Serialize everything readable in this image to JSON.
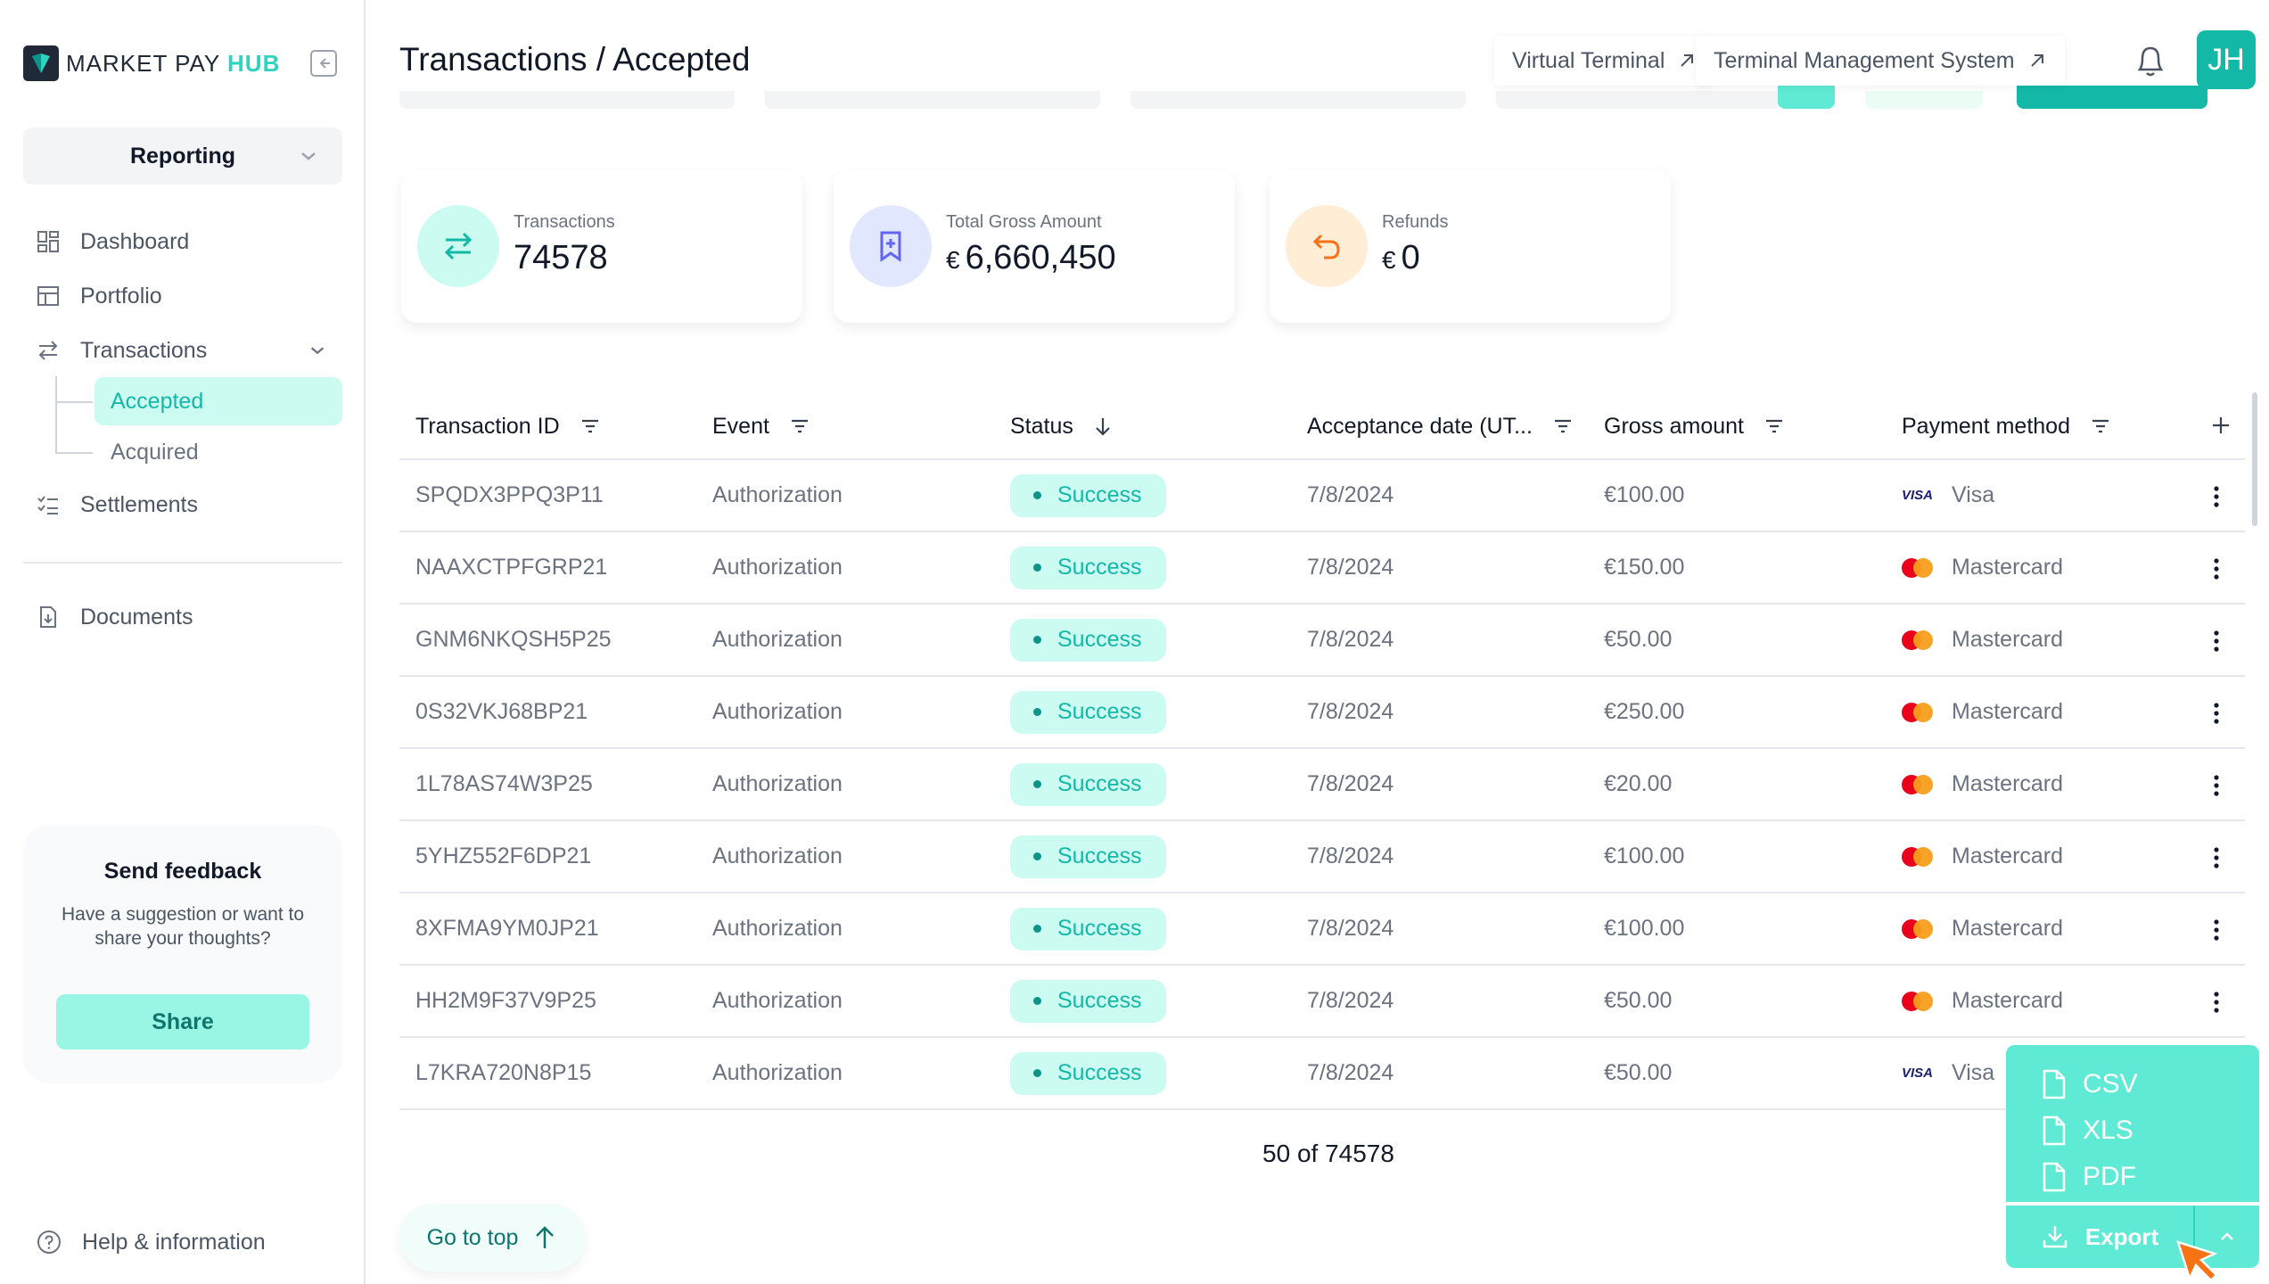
{
  "brand": {
    "name": "MARKET PAY",
    "suffix": "HUB"
  },
  "sidebar": {
    "module": "Reporting",
    "nav": [
      {
        "label": "Dashboard",
        "icon": "dashboard-icon"
      },
      {
        "label": "Portfolio",
        "icon": "portfolio-icon"
      },
      {
        "label": "Transactions",
        "icon": "transfer-icon"
      },
      {
        "label": "Settlements",
        "icon": "checklist-icon"
      },
      {
        "label": "Documents",
        "icon": "document-download-icon"
      }
    ],
    "transactions_sub": [
      {
        "label": "Accepted",
        "active": true
      },
      {
        "label": "Acquired",
        "active": false
      }
    ],
    "help": "Help & information"
  },
  "feedback": {
    "title": "Send feedback",
    "text": "Have a suggestion or want to share your thoughts?",
    "button": "Share"
  },
  "header": {
    "title": "Transactions / Accepted",
    "links": [
      "Virtual Terminal",
      "Terminal Management System"
    ],
    "avatar": "JH"
  },
  "kpis": [
    {
      "label": "Transactions",
      "value": "74578",
      "currency": "",
      "icon": "arrows-exchange-icon",
      "color": "#14b8a6"
    },
    {
      "label": "Total Gross Amount",
      "value": "6,660,450",
      "currency": "€",
      "icon": "bookmark-plus-icon",
      "color": "#6366f1"
    },
    {
      "label": "Refunds",
      "value": "0",
      "currency": "€",
      "icon": "undo-arrow-icon",
      "color": "#f97316"
    }
  ],
  "table": {
    "columns": [
      "Transaction ID",
      "Event",
      "Status",
      "Acceptance date (UT...",
      "Gross amount",
      "Payment method"
    ],
    "rows": [
      {
        "id": "SPQDX3PPQ3P11",
        "event": "Authorization",
        "status": "Success",
        "date": "7/8/2024",
        "amount": "€100.00",
        "method": "Visa",
        "brand": "visa"
      },
      {
        "id": "NAAXCTPFGRP21",
        "event": "Authorization",
        "status": "Success",
        "date": "7/8/2024",
        "amount": "€150.00",
        "method": "Mastercard",
        "brand": "mc"
      },
      {
        "id": "GNM6NKQSH5P25",
        "event": "Authorization",
        "status": "Success",
        "date": "7/8/2024",
        "amount": "€50.00",
        "method": "Mastercard",
        "brand": "mc"
      },
      {
        "id": "0S32VKJ68BP21",
        "event": "Authorization",
        "status": "Success",
        "date": "7/8/2024",
        "amount": "€250.00",
        "method": "Mastercard",
        "brand": "mc"
      },
      {
        "id": "1L78AS74W3P25",
        "event": "Authorization",
        "status": "Success",
        "date": "7/8/2024",
        "amount": "€20.00",
        "method": "Mastercard",
        "brand": "mc"
      },
      {
        "id": "5YHZ552F6DP21",
        "event": "Authorization",
        "status": "Success",
        "date": "7/8/2024",
        "amount": "€100.00",
        "method": "Mastercard",
        "brand": "mc"
      },
      {
        "id": "8XFMA9YM0JP21",
        "event": "Authorization",
        "status": "Success",
        "date": "7/8/2024",
        "amount": "€100.00",
        "method": "Mastercard",
        "brand": "mc"
      },
      {
        "id": "HH2M9F37V9P25",
        "event": "Authorization",
        "status": "Success",
        "date": "7/8/2024",
        "amount": "€50.00",
        "method": "Mastercard",
        "brand": "mc"
      },
      {
        "id": "L7KRA720N8P15",
        "event": "Authorization",
        "status": "Success",
        "date": "7/8/2024",
        "amount": "€50.00",
        "method": "Visa",
        "brand": "visa"
      }
    ],
    "visa_logo_text": "VISA"
  },
  "pager": "50 of 74578",
  "go_top": "Go to top",
  "export": {
    "options": [
      "CSV",
      "XLS",
      "PDF"
    ],
    "label": "Export"
  },
  "colors": {
    "accent": "#14b8a6",
    "accent_light": "#ccfbf1",
    "export_bg": "#5eead4"
  }
}
